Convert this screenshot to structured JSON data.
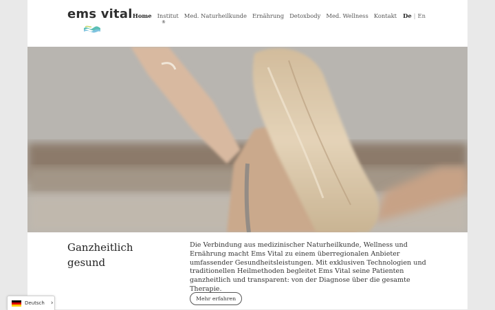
{
  "brand": {
    "name": "ems vital",
    "reg_mark": "®",
    "logo_colors": [
      "#5bbfb5",
      "#7ec3df",
      "#c5d96a"
    ]
  },
  "nav": {
    "items": [
      {
        "label": "Home",
        "active": true
      },
      {
        "label": "Institut"
      },
      {
        "label": "Med. Naturheilkunde"
      },
      {
        "label": "Ernährung"
      },
      {
        "label": "Detoxbody"
      },
      {
        "label": "Med. Wellness"
      },
      {
        "label": "Kontakt"
      }
    ],
    "lang_current": "De",
    "lang_separator": "|",
    "lang_other": "En"
  },
  "hero": {
    "subject": "woman-with-outstretched-arms-photo"
  },
  "intro": {
    "heading": "Ganzheitlich gesund",
    "text": "Die Verbindung aus medizinischer Naturheilkunde, Wellness und Ernährung macht Ems Vital zu einem überregionalen Anbieter umfassender Gesundheitsleistungen. Mit exklusiven Technologien und traditionellen Heilmethoden begleitet Ems Vital seine Patienten ganzheitlich und transparent: von der Diagnose über die gesamte Therapie.",
    "button_label": "Mehr erfahren"
  },
  "language_widget": {
    "label": "Deutsch",
    "flag_icon": "german-flag-icon",
    "chevron_icon": "chevron-right-icon"
  }
}
